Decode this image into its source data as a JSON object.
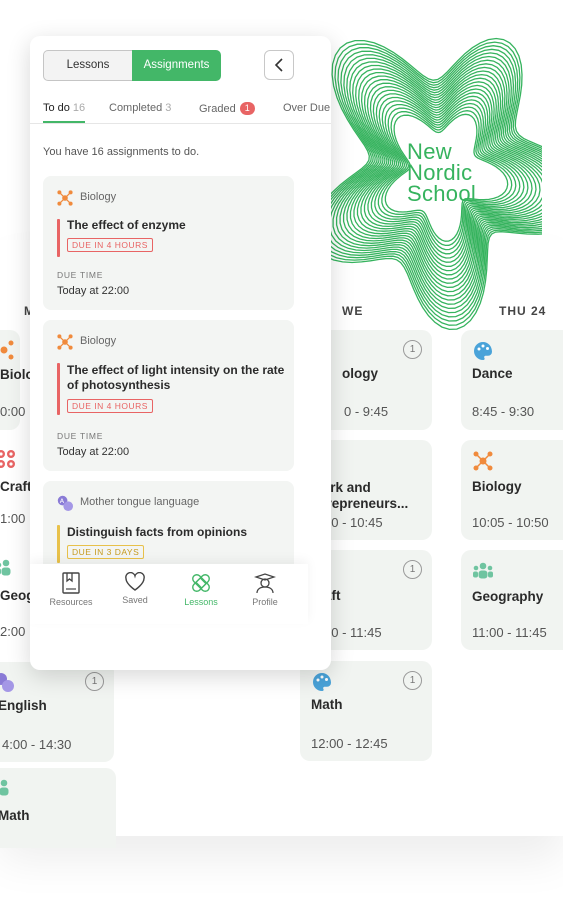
{
  "logo": {
    "lines": [
      "New",
      "Nordic",
      "School"
    ],
    "color": "#36b35e"
  },
  "phone": {
    "segments": {
      "lessons": "Lessons",
      "assignments": "Assignments"
    },
    "tabs": [
      {
        "label": "To do",
        "count": "16"
      },
      {
        "label": "Completed",
        "count": "3"
      },
      {
        "label": "Graded",
        "count": "1"
      },
      {
        "label": "Over Due",
        "count": ""
      }
    ],
    "summary": "You have 16 assignments to do.",
    "assignments": [
      {
        "subject": "Biology",
        "title": "The effect of enzyme",
        "due": "DUE IN 4 HOURS",
        "due_label": "DUE TIME",
        "due_time": "Today at 22:00"
      },
      {
        "subject": "Biology",
        "title": "The effect of light intensity on the rate of photosynthesis",
        "due": "DUE IN 4 HOURS",
        "due_label": "DUE TIME",
        "due_time": "Today at 22:00"
      },
      {
        "subject": "Mother tongue language",
        "title": "Distinguish facts from opinions",
        "due": "DUE IN 3 DAYS"
      }
    ],
    "nav": [
      "Resources",
      "Saved",
      "Lessons",
      "Profile"
    ]
  },
  "calendar": {
    "headers": [
      "M",
      "WE",
      "THU 24"
    ],
    "left_column": [
      {
        "title": "Biolo",
        "time": "0:00"
      },
      {
        "title": "Craft",
        "time": "1:00"
      },
      {
        "title": "Geog",
        "time": "2:00"
      },
      {
        "title": "English",
        "time": "4:00 - 14:30",
        "badge": "1"
      },
      {
        "title": "Math",
        "time": ""
      }
    ],
    "wed_column": [
      {
        "title": "ology",
        "time": "0 - 9:45",
        "badge": "1"
      },
      {
        "title": "ork and trepreneurs...",
        "time": "00 - 10:45"
      },
      {
        "title": "aft",
        "time": "00 - 11:45",
        "badge": "1"
      },
      {
        "title": "Math",
        "time": "12:00 - 12:45",
        "badge": "1"
      }
    ],
    "thu_column": [
      {
        "title": "Dance",
        "time": "8:45 - 9:30"
      },
      {
        "title": "Biology",
        "time": "10:05 - 10:50"
      },
      {
        "title": "Geography",
        "time": "11:00 - 11:45"
      }
    ]
  },
  "colors": {
    "accent": "#43b768",
    "due_red": "#e86464",
    "due_yellow": "#e8c14a",
    "biology": "#f08a3c"
  }
}
